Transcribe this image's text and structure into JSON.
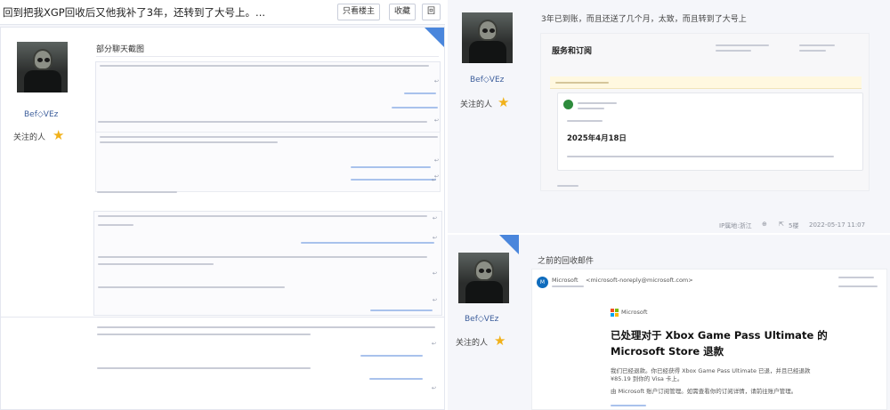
{
  "left_panel": {
    "thread_title": "回到把我XGP回收后又他我补了3年，还转到了大号上。...",
    "buttons": [
      "只看楼主",
      "收藏",
      "回"
    ],
    "posts": [
      {
        "username": "Bef◇VEz",
        "badge_label": "关注的人",
        "section_heading": "部分聊天截图"
      }
    ]
  },
  "right_top": {
    "caption": "3年已到账，而且还送了几个月，太致，而且转到了大号上",
    "subscription_title": "服务和订阅",
    "card_date": "2025年4月18日",
    "footer": {
      "ip_label": "IP属地:浙江",
      "floor": "5楼",
      "timestamp": "2022-05-17 11:07"
    }
  },
  "right_bottom": {
    "username": "Bef◇VEz",
    "badge_label": "关注的人",
    "caption": "之前的回收邮件",
    "sender_name": "Microsoft",
    "sender_email": "<microsoft-noreply@microsoft.com>",
    "brand_label": "Microsoft",
    "mail_title_line1": "已处理对于 Xbox Game Pass Ultimate 的",
    "mail_title_line2": "Microsoft Store 退款",
    "body_line1": "我们已经退款。你已经获得 Xbox Game Pass Ultimate 已退，并且已经退款",
    "body_line2": "¥85.19 到你的 Visa 卡上。",
    "body_line3": "由 Microsoft 账户订阅管理。如需查看你的订阅详情，请前往账户管理。"
  },
  "colors": {
    "accent_blue": "#4a86dc",
    "link_blue": "#3e5f9c",
    "star_gold": "#f1b11a",
    "xbox_green": "#2d8b3c"
  },
  "icons": {
    "star": "★",
    "reply": "↩"
  }
}
